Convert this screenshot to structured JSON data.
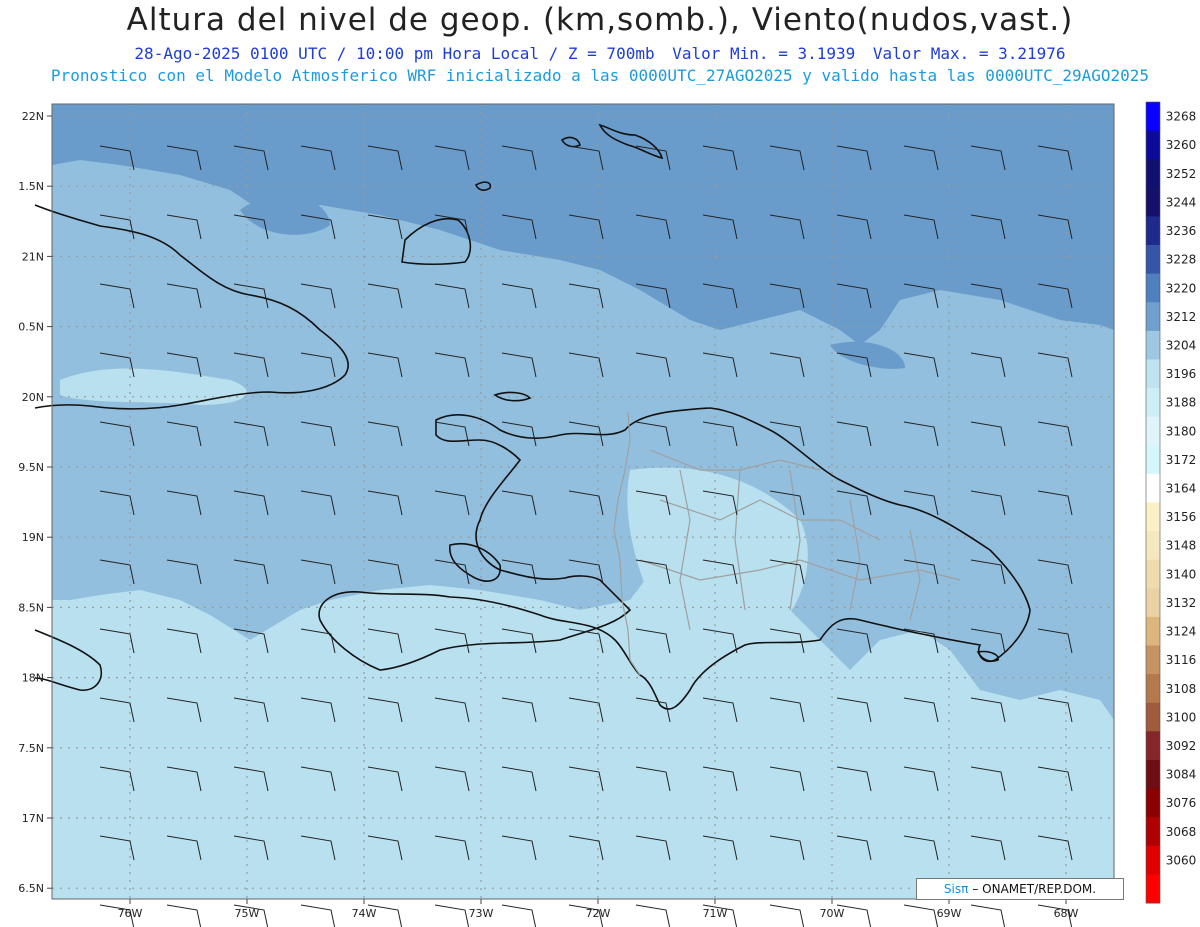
{
  "title": "Altura del nivel de geop. (km,somb.), Viento(nudos,vast.)",
  "subtitle": {
    "valid_time": "28-Ago-2025  0100 UTC / 10:00 pm Hora Local / Z = 700mb",
    "min_label": "Valor Min. = 3.1939",
    "max_label": "Valor Max. = 3.21976"
  },
  "model_info": "Pronostico con el Modelo Atmosferico WRF inicializado a las 0000UTC_27AGO2025 y valido hasta las  0000UTC_29AGO2025",
  "credit": {
    "brand": "Sisπ",
    "org": "– ONAMET/REP.DOM."
  },
  "axes": {
    "lon_labels": [
      "76W",
      "75W",
      "74W",
      "73W",
      "72W",
      "71W",
      "70W",
      "69W",
      "68W"
    ],
    "lat_labels": [
      "22N",
      "1.5N",
      "21N",
      "0.5N",
      "20N",
      "9.5N",
      "19N",
      "8.5N",
      "18N",
      "7.5N",
      "17N",
      "6.5N"
    ]
  },
  "colorbar": {
    "levels": [
      3268,
      3260,
      3252,
      3244,
      3236,
      3228,
      3220,
      3212,
      3204,
      3196,
      3188,
      3180,
      3172,
      3164,
      3156,
      3148,
      3140,
      3132,
      3124,
      3116,
      3108,
      3100,
      3092,
      3084,
      3076,
      3068,
      3060
    ],
    "colors": [
      "#0a00ff",
      "#0b0a9c",
      "#101070",
      "#15106a",
      "#1e2a8c",
      "#3556a8",
      "#4f7fbd",
      "#6e9fcd",
      "#9ec8e2",
      "#bfe4ef",
      "#cdeef5",
      "#e0f5fa",
      "#d4f7fb",
      "#ffffff",
      "#fbf1c6",
      "#f5e8c0",
      "#efdcae",
      "#ead2a4",
      "#ddb67d",
      "#c89363",
      "#b47a4e",
      "#a05a3c",
      "#86262a",
      "#6e0e14",
      "#8c0000",
      "#b00000",
      "#e00000",
      "#ff0000"
    ]
  },
  "field_colors": {
    "high": "#6a9ccb",
    "mid": "#92bfdd",
    "low": "#b8e0ee",
    "coast": "#111111",
    "border": "#a0a0a0",
    "barb": "#222222"
  }
}
